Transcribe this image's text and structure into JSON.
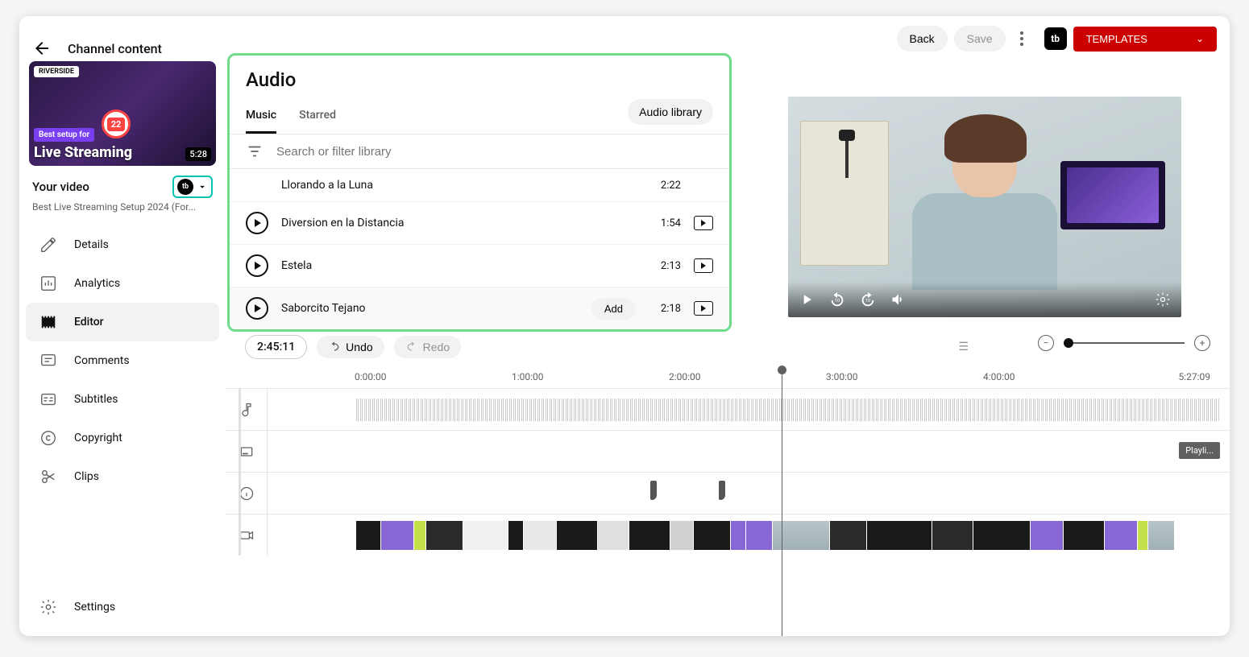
{
  "header": {
    "channel_content": "Channel content",
    "back": "Back",
    "save": "Save",
    "templates": "TEMPLATES"
  },
  "sidebar": {
    "thumb_badge": "RIVERSIDE",
    "thumb_setup": "Best setup for",
    "thumb_title": "Live Streaming",
    "thumb_circle": "22",
    "thumb_duration": "5:28",
    "your_video": "Your video",
    "video_desc": "Best Live Streaming Setup 2024 (For...",
    "nav": {
      "details": "Details",
      "analytics": "Analytics",
      "editor": "Editor",
      "comments": "Comments",
      "subtitles": "Subtitles",
      "copyright": "Copyright",
      "clips": "Clips",
      "settings": "Settings"
    }
  },
  "audio": {
    "title": "Audio",
    "tab_music": "Music",
    "tab_starred": "Starred",
    "library_btn": "Audio library",
    "search_placeholder": "Search or filter library",
    "tracks": [
      {
        "name": "Llorando a la Luna",
        "dur": "2:22"
      },
      {
        "name": "Diversion en la Distancia",
        "dur": "1:54"
      },
      {
        "name": "Estela",
        "dur": "2:13"
      },
      {
        "name": "Saborcito Tejano",
        "dur": "2:18"
      }
    ],
    "add": "Add"
  },
  "timeline": {
    "time": "2:45:11",
    "undo": "Undo",
    "redo": "Redo",
    "ruler": [
      "0:00:00",
      "1:00:00",
      "2:00:00",
      "3:00:00",
      "4:00:00",
      "5:27:09"
    ],
    "playlist_chip": "Playli..."
  }
}
